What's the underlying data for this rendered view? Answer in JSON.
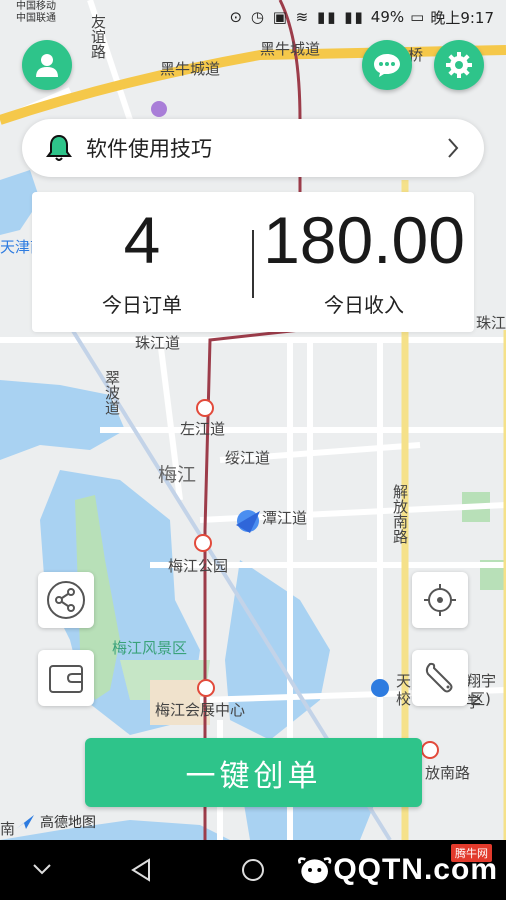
{
  "status_bar": {
    "carrier_top": "中国移动",
    "carrier_bottom": "中国联通",
    "battery": "49%",
    "time": "晚上9:17"
  },
  "header": {
    "profile_icon": "person-icon",
    "message_icon": "chat-icon",
    "settings_icon": "gear-icon"
  },
  "tips": {
    "label": "软件使用技巧",
    "icon": "bell-icon"
  },
  "stats": {
    "orders_value": "4",
    "orders_label": "今日订单",
    "income_value": "180.00",
    "income_label": "今日收入"
  },
  "map": {
    "labels": {
      "road_top": "黑牛城道",
      "road_top2": "黑牛城道",
      "bridge": "桥",
      "youyi": "友谊路",
      "tianjin": "天津南",
      "zhujiang_left": "珠江道",
      "zhujiang_right": "珠江",
      "cuibo": "翠波道",
      "zuojiang": "左江道",
      "suijiang": "绥江道",
      "meijiang": "梅江",
      "tanjiang": "潭江道",
      "jiefang": "解放南路",
      "park": "梅江公园",
      "scenic": "梅江风景区",
      "expo": "梅江会展中心",
      "school": "天",
      "school2": "校",
      "xiangyu": "翔宇学",
      "district": "区)",
      "fang_south": "放南路",
      "south": "南",
      "logo": "高德地图"
    }
  },
  "side_buttons": {
    "share_icon": "share-icon",
    "wallet_icon": "wallet-icon",
    "locate_icon": "crosshair-icon",
    "tools_icon": "wrench-icon"
  },
  "create_button": {
    "label": "一键创单"
  },
  "nav": {
    "back_icon": "back-triangle-icon",
    "home_icon": "home-circle-icon"
  },
  "watermark": {
    "text": "QQTN.com",
    "tag": "腾牛网"
  }
}
